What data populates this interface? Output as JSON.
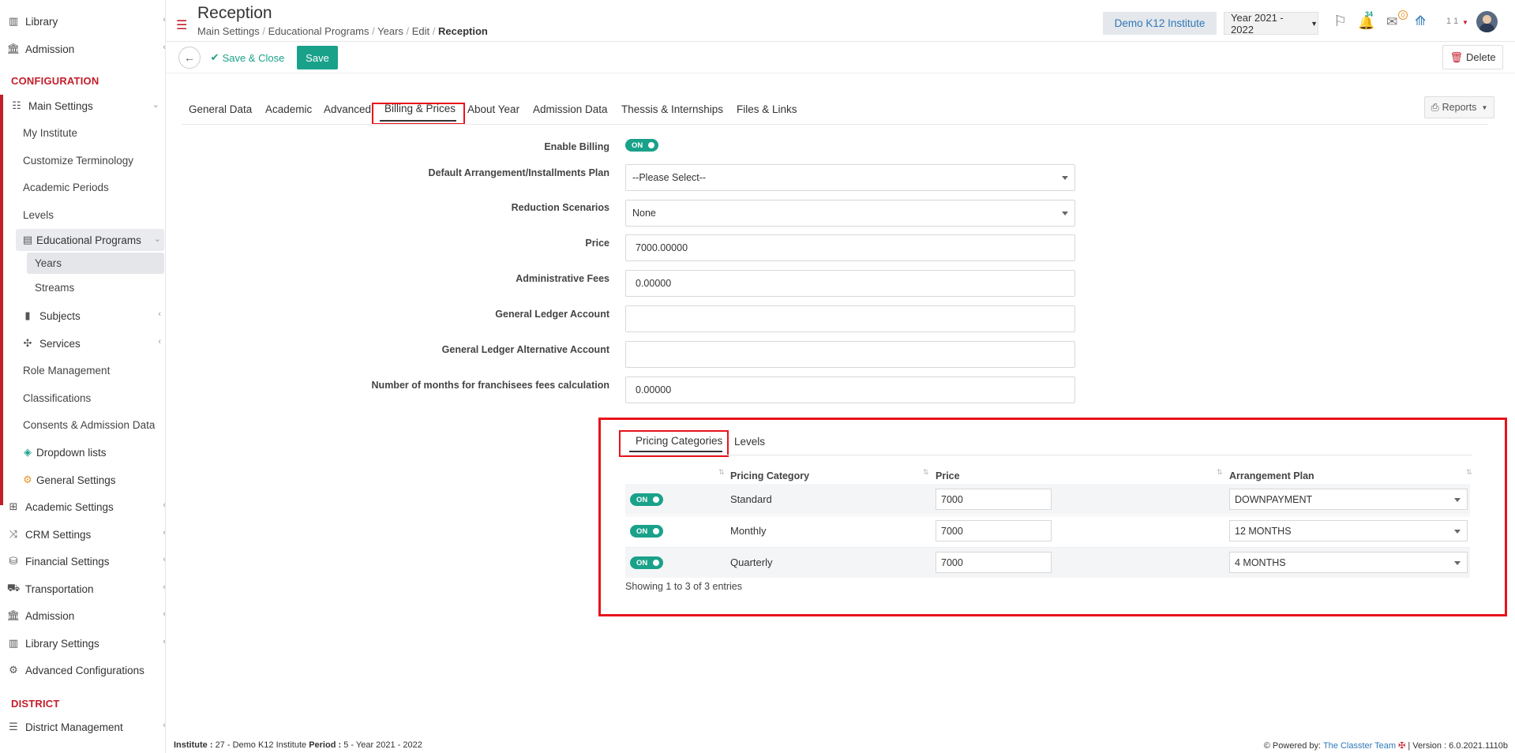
{
  "sidebar": {
    "top_items": [
      {
        "label": "Library",
        "icon": "books-icon"
      },
      {
        "label": "Admission",
        "icon": "building-icon"
      }
    ],
    "section_configuration": "CONFIGURATION",
    "main_settings": "Main Settings",
    "main_sub": [
      "My Institute",
      "Customize Terminology",
      "Academic Periods",
      "Levels"
    ],
    "educational_programs": "Educational Programs",
    "edu_sub": [
      "Years",
      "Streams"
    ],
    "subjects": "Subjects",
    "services": "Services",
    "other_sub": [
      "Role Management",
      "Classifications",
      "Consents & Admission Data"
    ],
    "dropdown_lists": "Dropdown lists",
    "general_settings": "General Settings",
    "bottom_items": [
      "Academic Settings",
      "CRM Settings",
      "Financial Settings",
      "Transportation",
      "Admission",
      "Library Settings",
      "Advanced Configurations"
    ],
    "section_district": "DISTRICT",
    "district_management": "District Management"
  },
  "header": {
    "title": "Reception",
    "breadcrumb": [
      "Main Settings",
      "Educational Programs",
      "Years",
      "Edit",
      "Reception"
    ],
    "institute": "Demo K12 Institute",
    "year": "Year 2021 - 2022",
    "notifications_count": "34",
    "messages_count": "0",
    "user_label": "1 1"
  },
  "toolbar": {
    "save_close": "Save & Close",
    "save": "Save",
    "delete": "Delete"
  },
  "tabs": [
    "General Data",
    "Academic",
    "Advanced",
    "Billing & Prices",
    "About Year",
    "Admission Data",
    "Thessis & Internships",
    "Files & Links"
  ],
  "reports": "Reports",
  "form": {
    "enable_billing_label": "Enable Billing",
    "enable_billing_value": "ON",
    "arrangement_label": "Default Arrangement/Installments Plan",
    "arrangement_value": "--Please Select--",
    "reduction_label": "Reduction Scenarios",
    "reduction_value": "None",
    "price_label": "Price",
    "price_value": "7000.00000",
    "admin_fees_label": "Administrative Fees",
    "admin_fees_value": "0.00000",
    "gl_label": "General Ledger Account",
    "gl_value": "",
    "gl_alt_label": "General Ledger Alternative Account",
    "gl_alt_value": "",
    "months_label": "Number of months for franchisees fees calculation",
    "months_value": "0.00000"
  },
  "pricing": {
    "tabs": [
      "Pricing Categories",
      "Levels"
    ],
    "columns": [
      "Pricing Category",
      "Price",
      "Arrangement Plan"
    ],
    "rows": [
      {
        "toggle": "ON",
        "category": "Standard",
        "price": "7000",
        "plan": "DOWNPAYMENT"
      },
      {
        "toggle": "ON",
        "category": "Monthly",
        "price": "7000",
        "plan": "12 MONTHS"
      },
      {
        "toggle": "ON",
        "category": "Quarterly",
        "price": "7000",
        "plan": "4 MONTHS"
      }
    ],
    "info": "Showing 1 to 3 of 3 entries"
  },
  "footer": {
    "institute_label": "Institute :",
    "institute_value": "27 - Demo K12 Institute",
    "period_label": "Period :",
    "period_value": "5 - Year 2021 - 2022",
    "powered_label": "Powered by:",
    "powered_link": "The Classter Team",
    "version": "| Version : 6.0.2021.1110b"
  },
  "colors": {
    "accent": "#1aa18a",
    "brand_red": "#c31d2a",
    "highlight": "#e8131b"
  }
}
